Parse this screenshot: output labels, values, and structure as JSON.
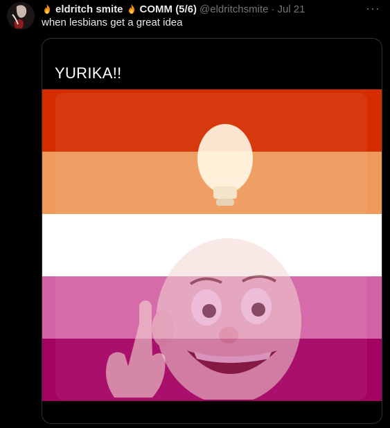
{
  "tweet": {
    "display_name": "eldritch smite",
    "community": "COMM (5/6)",
    "handle": "@eldritchsmite",
    "separator": "·",
    "date": "Jul 21",
    "text": "when lesbians get a great idea",
    "more_icon": "more-horizontal-icon"
  },
  "media": {
    "caption": "YURIKA!!",
    "flag_stripes": [
      "#d52d00",
      "#ef9a5a",
      "#ffffff",
      "#d362a4",
      "#a30262"
    ]
  }
}
